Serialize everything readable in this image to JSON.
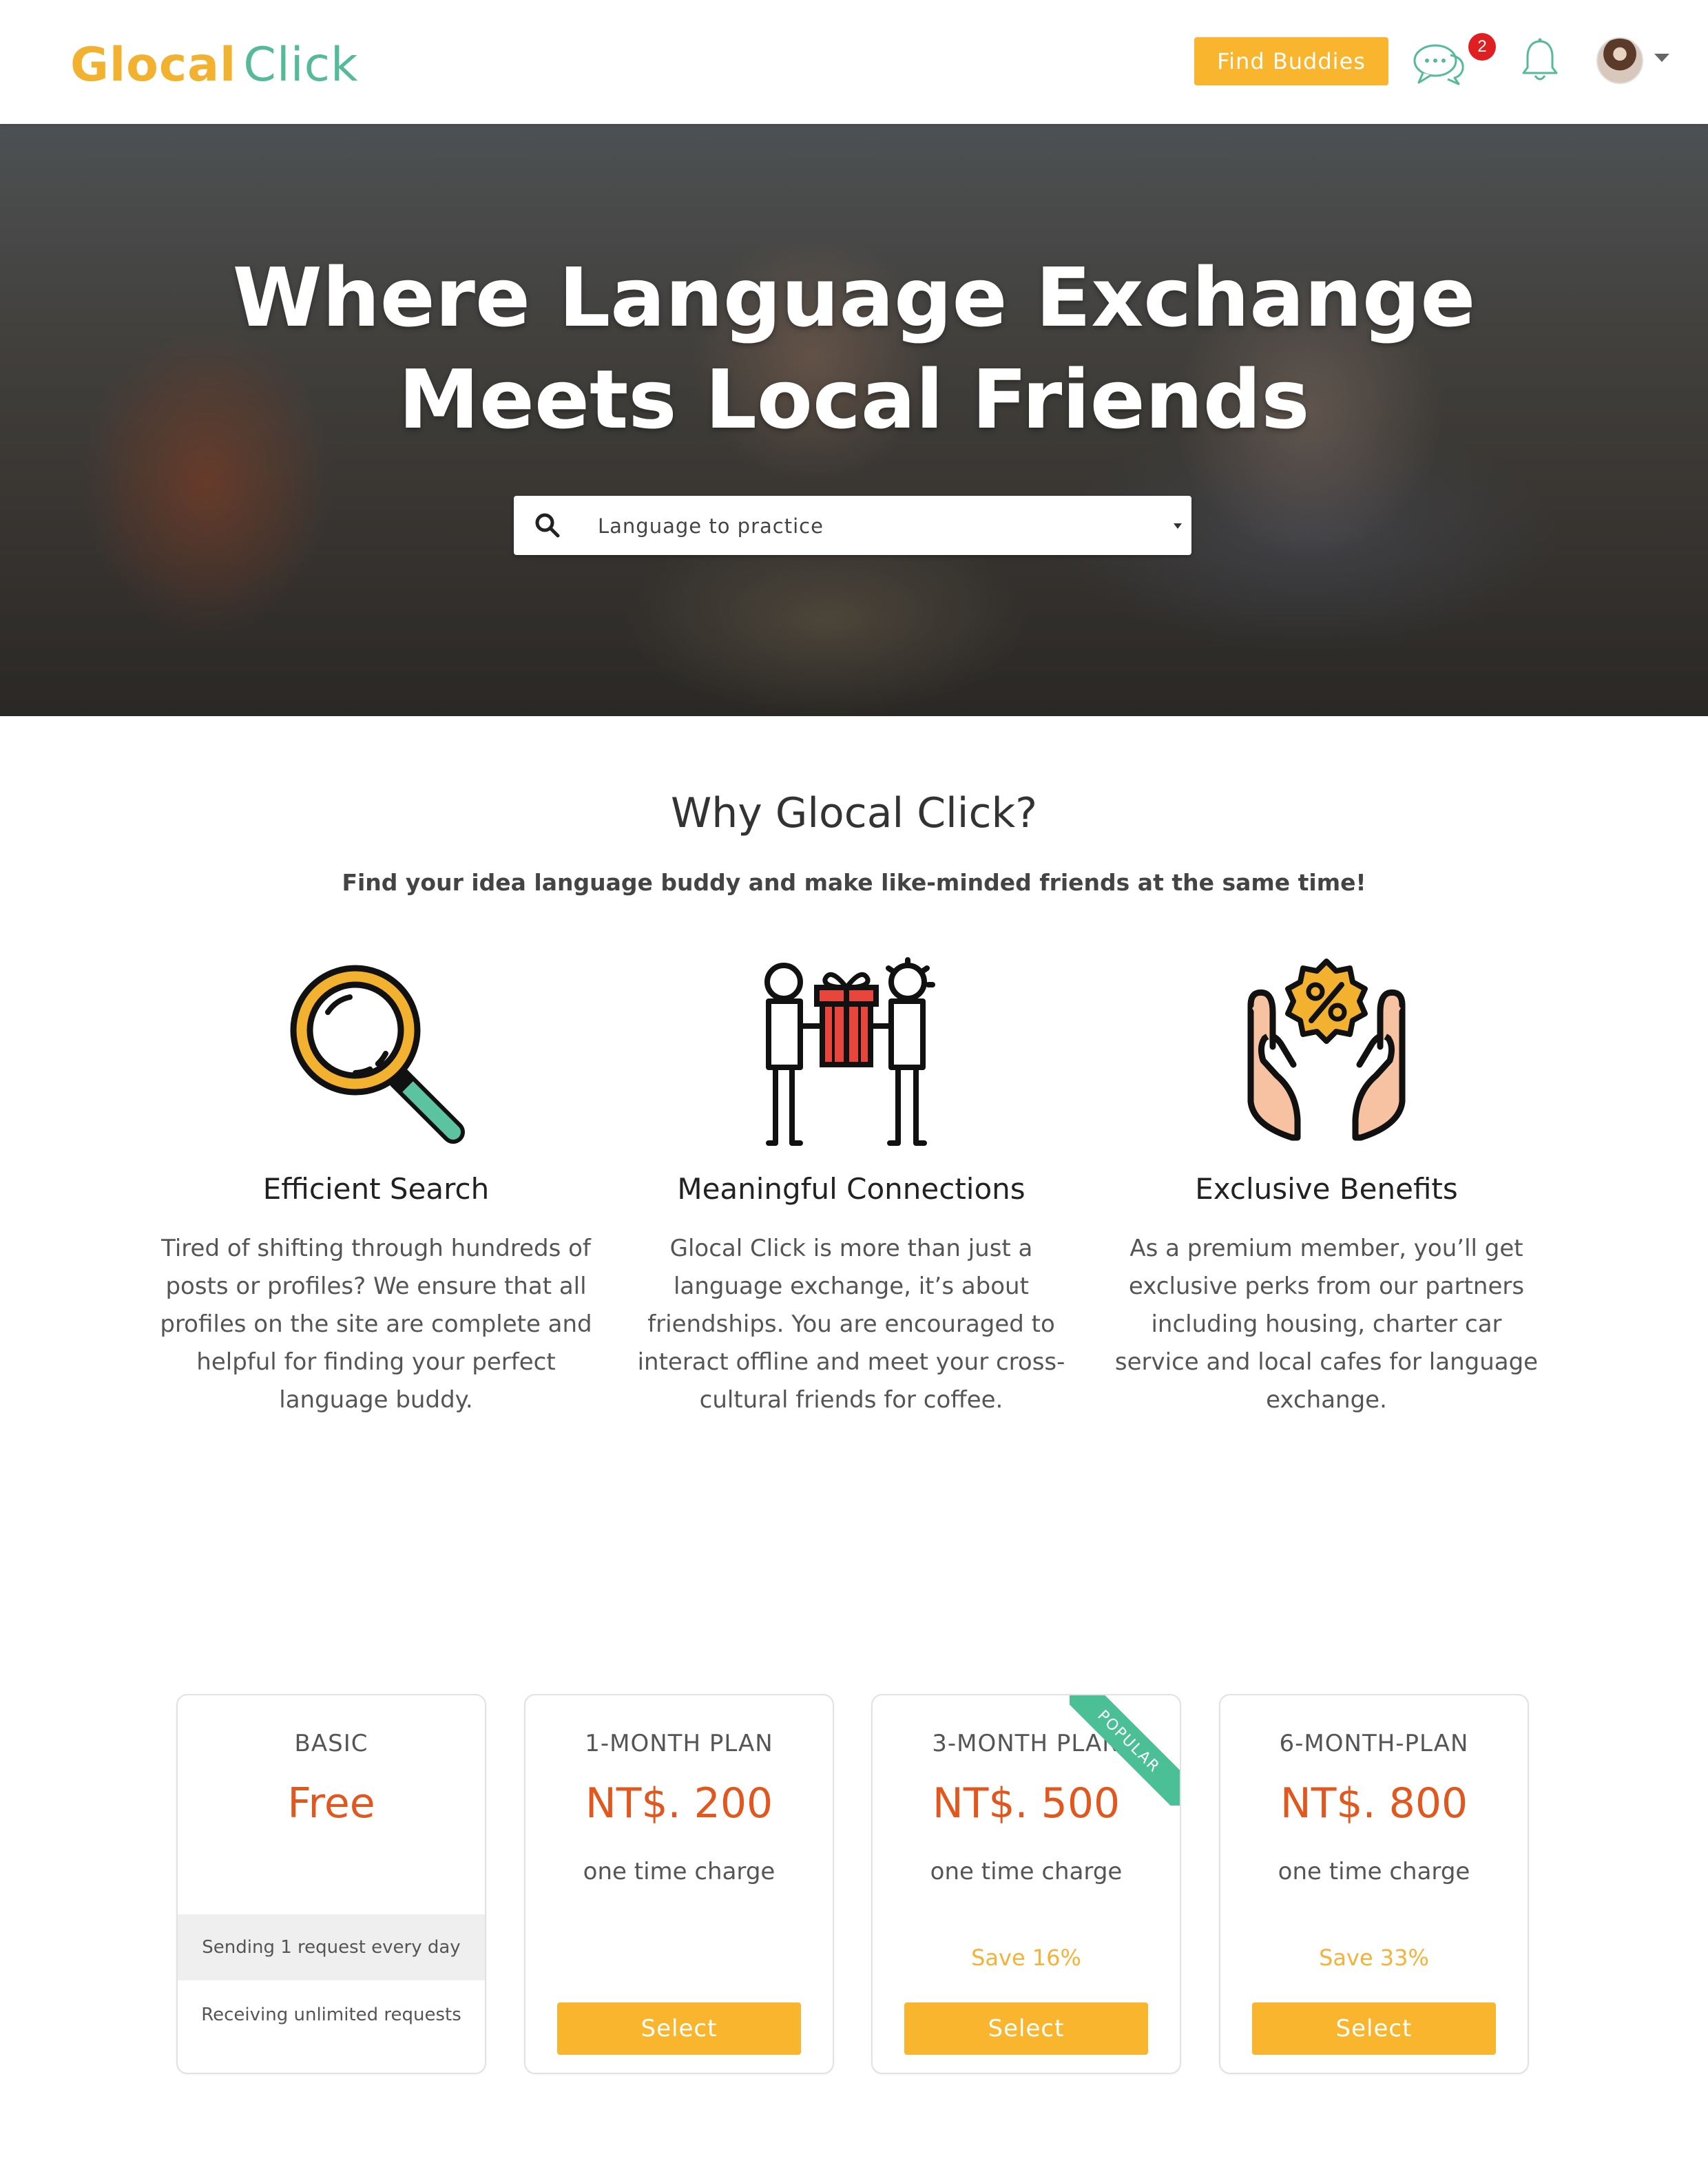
{
  "header": {
    "logo_part1": "Glocal",
    "logo_part2": "Click",
    "find_buddies_label": "Find Buddies",
    "messages_badge": "2"
  },
  "hero": {
    "title_line1": "Where Language Exchange",
    "title_line2": "Meets Local Friends",
    "search_placeholder": "Language to practice"
  },
  "why": {
    "title": "Why Glocal Click?",
    "subtitle": "Find your idea language buddy and make like-minded friends at the same time!",
    "features": [
      {
        "icon": "magnifier-icon",
        "title": "Efficient Search",
        "text": "Tired of shifting through hundreds of posts or profiles? We ensure that all profiles on the site are complete and helpful for finding your perfect language buddy."
      },
      {
        "icon": "gift-exchange-icon",
        "title": "Meaningful Connections",
        "text": "Glocal Click is more than just a language exchange, it’s about friendships. You are encouraged to interact offline and meet your cross-cultural friends for coffee."
      },
      {
        "icon": "discount-hands-icon",
        "title": "Exclusive Benefits",
        "text": "As a premium member, you’ll get exclusive perks from our partners including housing, charter car service and local cafes for language exchange."
      }
    ]
  },
  "pricing": {
    "plans": [
      {
        "name": "BASIC",
        "price": "Free",
        "features": [
          "Sending 1 request every day",
          "Receiving unlimited requests"
        ]
      },
      {
        "name": "1-MONTH PLAN",
        "price": "NT$. 200",
        "charge": "one time charge",
        "select_label": "Select"
      },
      {
        "name": "3-MONTH PLAN",
        "price": "NT$. 500",
        "charge": "one time charge",
        "save": "Save 16%",
        "ribbon": "POPULAR",
        "select_label": "Select"
      },
      {
        "name": "6-MONTH-PLAN",
        "price": "NT$. 800",
        "charge": "one time charge",
        "save": "Save 33%",
        "select_label": "Select"
      }
    ]
  },
  "colors": {
    "accent_yellow": "#f9b52d",
    "price_orange": "#e2571e",
    "brand_green": "#55b99a",
    "badge_red": "#e02020"
  }
}
